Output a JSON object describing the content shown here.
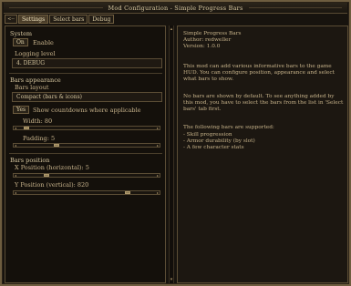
{
  "window": {
    "title": "Mod Configuration - Simple Progress Bars"
  },
  "tabs": [
    {
      "label": "<--"
    },
    {
      "label": "Settings"
    },
    {
      "label": "Select bars"
    },
    {
      "label": "Debug"
    }
  ],
  "system": {
    "title": "System",
    "enable_button": "On",
    "enable_label": "Enable",
    "logging_label": "Logging level",
    "logging_value": "4. DEBUG"
  },
  "appearance": {
    "title": "Bars appearance",
    "layout_label": "Bars layout",
    "layout_value": "Compact (bars & icons)",
    "countdown_button": "Yes",
    "countdown_label": "Show countdowns where applicable",
    "width_label": "Width: 80",
    "width_level": 0.05,
    "padding_label": "Padding: 5",
    "padding_level": 0.28
  },
  "position": {
    "title": "Bars position",
    "x_label": "X Position (horizontal): 5",
    "x_level": 0.2,
    "y_label": "Y Position (vertical): 820",
    "y_level": 0.82
  },
  "info": {
    "mod_name": "Simple Progress Bars",
    "author": "Author: redweller",
    "version": "Version: 1.0.0",
    "para1": "This mod can add various informative bars to the game HUD. You can configure position, appearance and select what bars to show.",
    "para2": "No bars are shown by default. To see anything added by this mod, you have to select the bars from the list in 'Select bars' tab first.",
    "para3": "The following bars are supported:",
    "items": [
      "- Skill progression",
      "- Armor durability (by slot)",
      "- A few character stats"
    ]
  }
}
